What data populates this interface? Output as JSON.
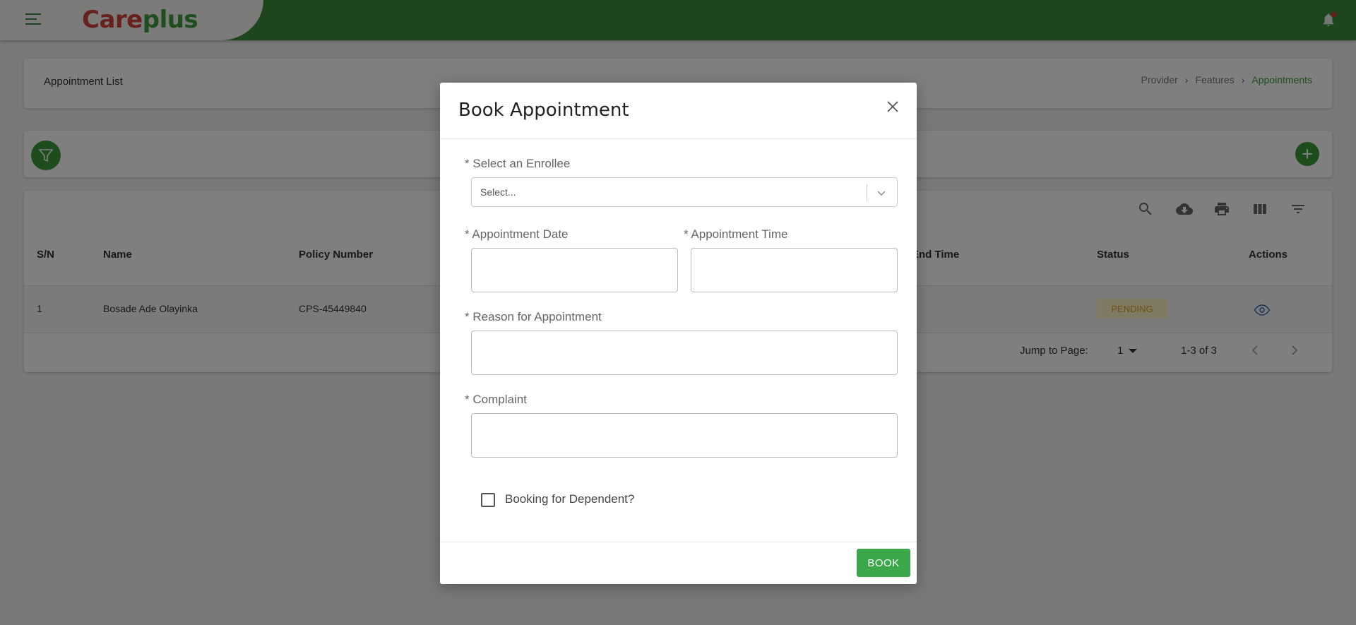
{
  "app": {
    "logo_care": "Care",
    "logo_plus": "plus"
  },
  "header": {
    "title": "Appointment List",
    "breadcrumb": [
      "Provider",
      "Features",
      "Appointments"
    ]
  },
  "table": {
    "columns": [
      "S/N",
      "Name",
      "Policy Number",
      "End Time",
      "Status",
      "Actions"
    ],
    "rows": [
      {
        "sn": "1",
        "name": "Bosade Ade Olayinka",
        "policy": "CPS-45449840",
        "status": "PENDING"
      }
    ],
    "pager": {
      "jump_label": "Jump to Page:",
      "page": "1",
      "range": "1-3 of 3"
    }
  },
  "modal": {
    "title": "Book Appointment",
    "enrollee_label": "Select an Enrollee",
    "enrollee_placeholder": "Select...",
    "date_label": "Appointment Date",
    "time_label": "Appointment Time",
    "reason_label": "Reason for Appointment",
    "complaint_label": "Complaint",
    "required_mark": "*",
    "dependent_label": "Booking for Dependent?",
    "dependent_checked": false,
    "book_label": "BOOK"
  },
  "colors": {
    "brand_green": "#3c8c3c",
    "brand_red": "#d0433a",
    "button_green": "#3aa84a",
    "pending_text": "#d6a519"
  }
}
